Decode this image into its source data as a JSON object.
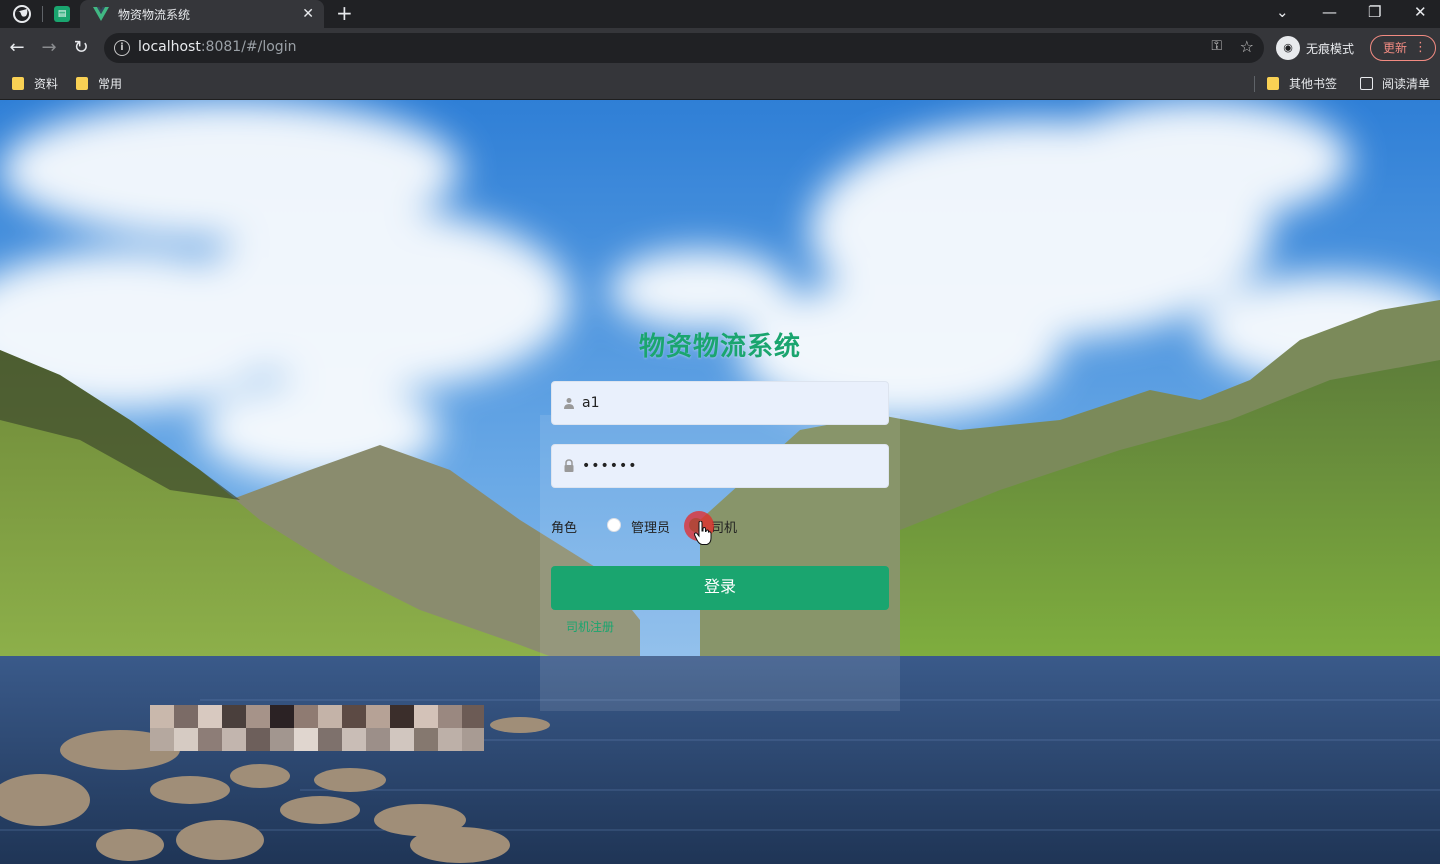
{
  "browser": {
    "tab_title": "物资物流系统",
    "url_host": "localhost",
    "url_rest": ":8081/#/login",
    "profile_label": "无痕模式",
    "update_label": "更新",
    "bookmarks": [
      "资料",
      "常用"
    ],
    "bookmarks_right": [
      "其他书签",
      "阅读清单"
    ]
  },
  "login": {
    "title": "物资物流系统",
    "username_value": "a1",
    "password_value": "••••••",
    "role_label": "角色",
    "roles": [
      "管理员",
      "司机"
    ],
    "selected_role": "司机",
    "submit_label": "登录",
    "register_link": "司机注册"
  },
  "colors": {
    "accent": "#1aa56f"
  }
}
